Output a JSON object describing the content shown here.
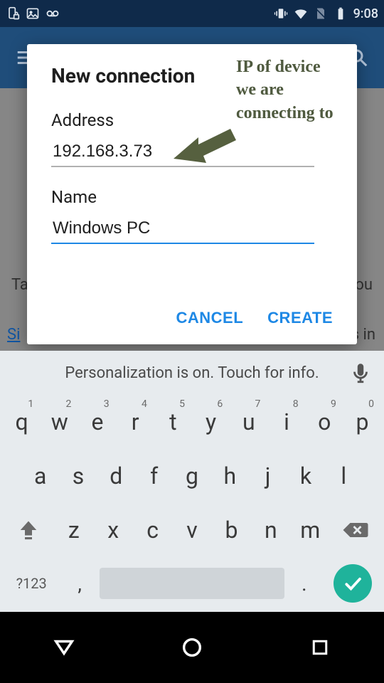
{
  "statusbar": {
    "time": "9:08"
  },
  "dialog": {
    "title": "New connection",
    "address_label": "Address",
    "address_value": "192.168.3.73",
    "name_label": "Name",
    "name_value": "Windows PC",
    "cancel": "CANCEL",
    "create": "CREATE"
  },
  "annotation": {
    "line1": "IP of device",
    "line2": "we are",
    "line3": "connecting to"
  },
  "background": {
    "hint_left": "Ta",
    "hint_right": "ou",
    "sign_left": "Si",
    "sign_right": "s in"
  },
  "keyboard": {
    "suggestion": "Personalization is on. Touch for info.",
    "row1": [
      "q",
      "w",
      "e",
      "r",
      "t",
      "y",
      "u",
      "i",
      "o",
      "p"
    ],
    "row1_hints": [
      "1",
      "2",
      "3",
      "4",
      "5",
      "6",
      "7",
      "8",
      "9",
      "0"
    ],
    "row2": [
      "a",
      "s",
      "d",
      "f",
      "g",
      "h",
      "j",
      "k",
      "l"
    ],
    "row3": [
      "z",
      "x",
      "c",
      "v",
      "b",
      "n",
      "m"
    ],
    "symkey": "?123",
    "comma": ",",
    "period": "."
  }
}
